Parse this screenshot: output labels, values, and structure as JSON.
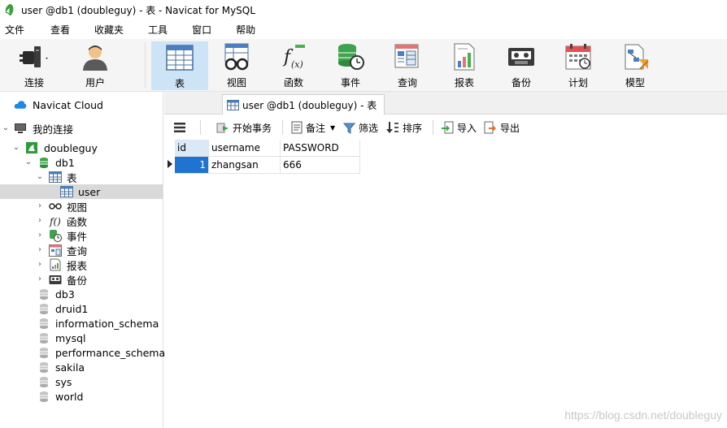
{
  "window": {
    "title": "user @db1 (doubleguy) - 表 - Navicat for MySQL"
  },
  "menu": [
    "文件",
    "查看",
    "收藏夹",
    "工具",
    "窗口",
    "帮助"
  ],
  "toolbar": {
    "connect": "连接",
    "user": "用户",
    "table": "表",
    "view": "视图",
    "function": "函数",
    "event": "事件",
    "query": "查询",
    "report": "报表",
    "backup": "备份",
    "schedule": "计划",
    "model": "模型"
  },
  "sidebar": {
    "cloud": "Navicat Cloud",
    "my_connections": "我的连接",
    "connection": "doubleguy",
    "db1": "db1",
    "tables": "表",
    "table_user": "user",
    "views": "视图",
    "functions": "函数",
    "events": "事件",
    "queries": "查询",
    "reports": "报表",
    "backups": "备份",
    "databases": [
      "db3",
      "druid1",
      "information_schema",
      "mysql",
      "performance_schema",
      "sakila",
      "sys",
      "world"
    ]
  },
  "tab": {
    "label": "user @db1 (doubleguy) - 表"
  },
  "subtoolbar": {
    "begin_transaction": "开始事务",
    "memo": "备注",
    "filter": "筛选",
    "sort": "排序",
    "import": "导入",
    "export": "导出"
  },
  "grid": {
    "columns": [
      "id",
      "username",
      "PASSWORD"
    ],
    "rows": [
      [
        "1",
        "zhangsan",
        "666"
      ]
    ]
  },
  "watermark": "https://blog.csdn.net/doubleguy"
}
